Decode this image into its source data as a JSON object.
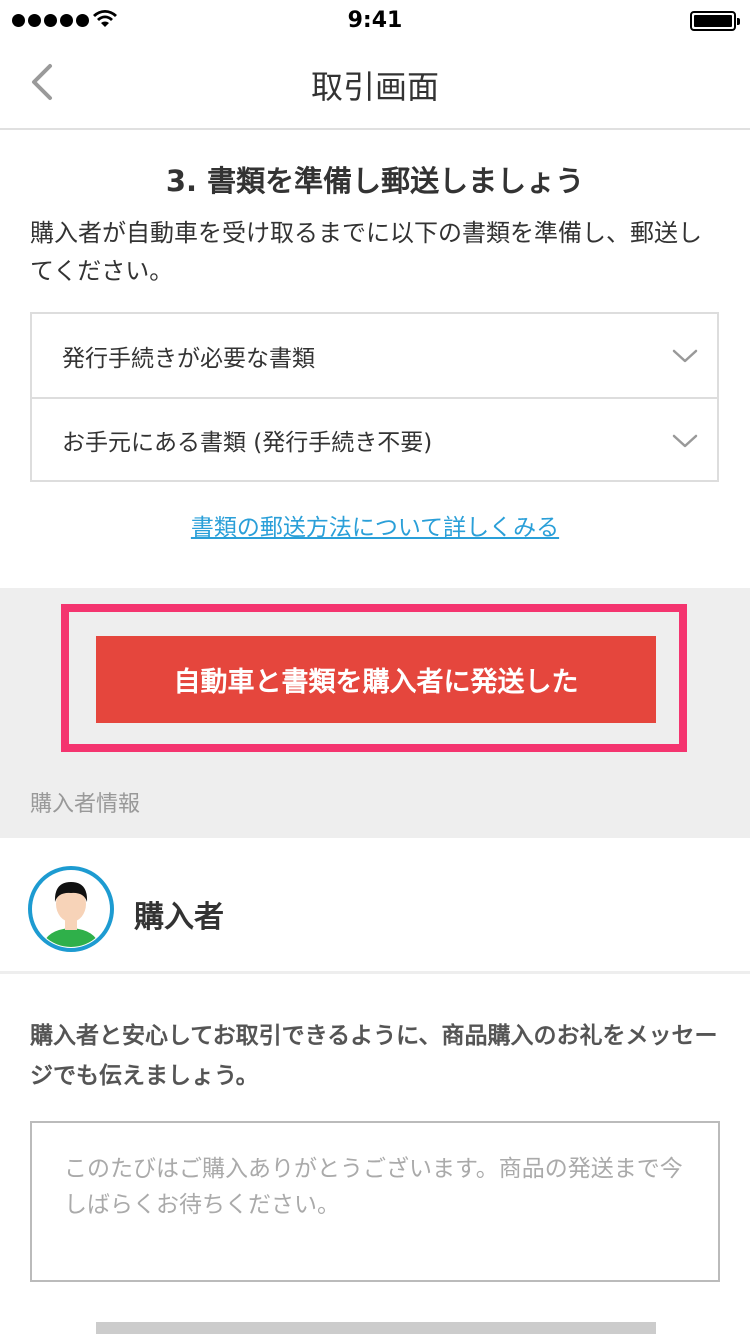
{
  "status_bar": {
    "time": "9:41",
    "signal_bars": 5
  },
  "nav": {
    "title": "取引画面",
    "back_icon": "chevron-left-icon"
  },
  "documents_section": {
    "title": "3. 書類を準備し郵送しましょう",
    "description": "購入者が自動車を受け取るまでに以下の書類を準備し、郵送してください。",
    "accordion": [
      {
        "label": "発行手続きが必要な書類",
        "icon": "chevron-down-icon"
      },
      {
        "label": "お手元にある書類 (発行手続き不要)",
        "icon": "chevron-down-icon"
      }
    ],
    "detail_link": "書類の郵送方法について詳しくみる"
  },
  "action": {
    "ship_button_label": "自動車と書類を購入者に発送した",
    "highlight_color": "#f4346f",
    "button_color": "#e5463d"
  },
  "buyer_info": {
    "section_label": "購入者情報",
    "buyer_name": "購入者",
    "avatar_icon": "user-avatar-icon"
  },
  "message": {
    "note": "購入者と安心してお取引できるように、商品購入のお礼をメッセージでも伝えましょう。",
    "placeholder": "このたびはご購入ありがとうございます。商品の発送まで今しばらくお待ちください。"
  },
  "colors": {
    "link": "#2a9fd8",
    "grey_panel": "#eeeeee"
  }
}
